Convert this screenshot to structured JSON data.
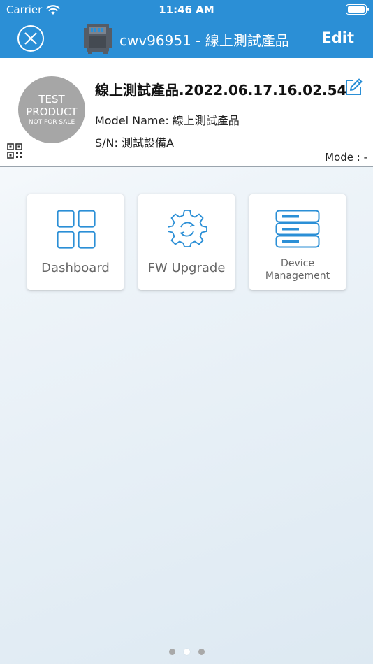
{
  "status_bar": {
    "carrier": "Carrier",
    "time": "11:46 AM"
  },
  "nav": {
    "title": "cwv96951 - 線上測試產品",
    "edit_label": "Edit"
  },
  "device": {
    "badge": {
      "line1": "TEST",
      "line2": "PRODUCT",
      "line3": "NOT FOR SALE"
    },
    "name": "線上測試產品.2022.06.17.16.02.54",
    "model_line": "Model Name: 線上測試產品",
    "sn_line": "S/N: 測試設備A",
    "mode_line": "Mode : -"
  },
  "tiles": [
    {
      "label": "Dashboard",
      "icon": "grid-icon"
    },
    {
      "label": "FW Upgrade",
      "icon": "gear-sync-icon"
    },
    {
      "label_line1": "Device",
      "label_line2": "Management",
      "icon": "server-stack-icon"
    }
  ],
  "pager": {
    "count": 3,
    "active_index": 1
  },
  "colors": {
    "nav_blue": "#2b8fd6",
    "icon_blue": "#2b8fd6",
    "badge_gray": "#a6a6a6"
  }
}
